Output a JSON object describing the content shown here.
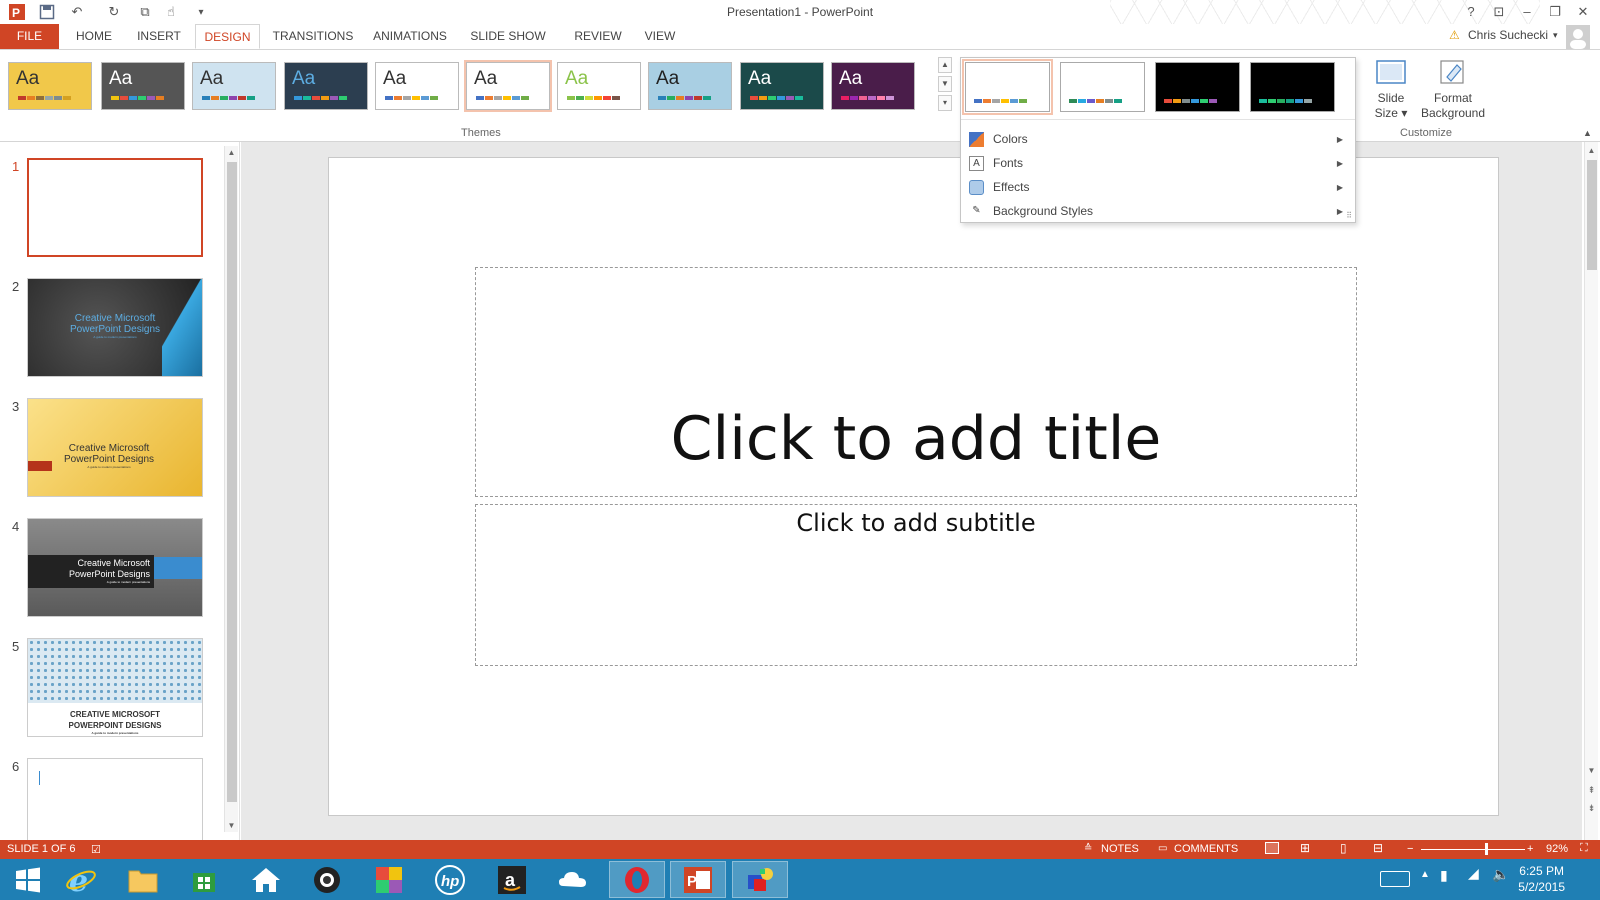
{
  "window": {
    "title": "Presentation1 - PowerPoint"
  },
  "user": {
    "name": "Chris Suchecki"
  },
  "tabs": [
    "FILE",
    "HOME",
    "INSERT",
    "DESIGN",
    "TRANSITIONS",
    "ANIMATIONS",
    "SLIDE SHOW",
    "REVIEW",
    "VIEW"
  ],
  "active_tab": "DESIGN",
  "ribbon": {
    "themes_label": "Themes",
    "customize_label": "Customize",
    "slide_size": {
      "line1": "Slide",
      "line2": "Size ▾"
    },
    "format_background": {
      "line1": "Format",
      "line2": "Background"
    },
    "theme_text": "Aa",
    "themes": [
      {
        "bg": "#f1c84a",
        "text": "#333",
        "swatch": [
          "#c0392b",
          "#e67e22",
          "#8e6e3a",
          "#95a5a6",
          "#7f8c8d",
          "#d4a020"
        ]
      },
      {
        "bg": "#555",
        "text": "#fff",
        "swatch": [
          "#f1c40f",
          "#e74c3c",
          "#3498db",
          "#2ecc71",
          "#9b59b6",
          "#e67e22"
        ]
      },
      {
        "bg": "#cfe3f0",
        "text": "#333",
        "swatch": [
          "#2980b9",
          "#e67e22",
          "#27ae60",
          "#8e44ad",
          "#c0392b",
          "#16a085"
        ]
      },
      {
        "bg": "#2c3e50",
        "text": "#5dade2",
        "swatch": [
          "#3498db",
          "#1abc9c",
          "#e74c3c",
          "#f39c12",
          "#9b59b6",
          "#2ecc71"
        ]
      },
      {
        "bg": "#ffffff",
        "text": "#333",
        "swatch": [
          "#4472c4",
          "#ed7d31",
          "#a5a5a5",
          "#ffc000",
          "#5b9bd5",
          "#70ad47"
        ]
      },
      {
        "bg": "#ffffff",
        "text": "#333",
        "swatch": [
          "#4472c4",
          "#ed7d31",
          "#a5a5a5",
          "#ffc000",
          "#5b9bd5",
          "#70ad47"
        ]
      },
      {
        "bg": "#ffffff",
        "text": "#8bc34a",
        "swatch": [
          "#8bc34a",
          "#4caf50",
          "#cddc39",
          "#ff9800",
          "#f44336",
          "#795548"
        ]
      },
      {
        "bg": "#a9cfe3",
        "text": "#222",
        "swatch": [
          "#2980b9",
          "#27ae60",
          "#e67e22",
          "#8e44ad",
          "#c0392b",
          "#16a085"
        ]
      },
      {
        "bg": "#1b4a4a",
        "text": "#fff",
        "swatch": [
          "#e74c3c",
          "#f39c12",
          "#2ecc71",
          "#3498db",
          "#9b59b6",
          "#1abc9c"
        ]
      },
      {
        "bg": "#4a1d4a",
        "text": "#fff",
        "swatch": [
          "#e91e63",
          "#9c27b0",
          "#f06292",
          "#ba68c8",
          "#ff80ab",
          "#ce93d8"
        ]
      }
    ],
    "variants": [
      {
        "bg": "#ffffff",
        "swatch": [
          "#4472c4",
          "#ed7d31",
          "#a5a5a5",
          "#ffc000",
          "#5b9bd5",
          "#70ad47"
        ]
      },
      {
        "bg": "#ffffff",
        "swatch": [
          "#2e8b57",
          "#27a9e1",
          "#6a5acd",
          "#e67e22",
          "#7f8c8d",
          "#16a085"
        ]
      },
      {
        "bg": "#000000",
        "swatch": [
          "#e74c3c",
          "#f39c12",
          "#7f8c8d",
          "#3498db",
          "#2ecc71",
          "#9b59b6"
        ]
      },
      {
        "bg": "#000000",
        "swatch": [
          "#1abc9c",
          "#2ecc71",
          "#27ae60",
          "#16a085",
          "#3498db",
          "#95a5a6"
        ]
      }
    ],
    "variant_menu": [
      "Colors",
      "Fonts",
      "Effects",
      "Background Styles"
    ]
  },
  "slides": [
    {
      "num": "1",
      "selected": true,
      "style": "blank"
    },
    {
      "num": "2",
      "style": "dark",
      "line1": "Creative Microsoft",
      "line2": "PowerPoint Designs",
      "sub": "A guide to modern presentations"
    },
    {
      "num": "3",
      "style": "yellow",
      "line1": "Creative Microsoft",
      "line2": "PowerPoint Designs",
      "sub": "A guide to modern presentations"
    },
    {
      "num": "4",
      "style": "gray",
      "line1": "Creative Microsoft",
      "line2": "PowerPoint Designs",
      "sub": "A guide to modern presentations"
    },
    {
      "num": "5",
      "style": "pattern",
      "line1": "CREATIVE MICROSOFT",
      "line2": "POWERPOINT DESIGNS",
      "sub": "A guide to modern presentations"
    },
    {
      "num": "6",
      "style": "blank"
    }
  ],
  "slide": {
    "title_placeholder": "Click to add title",
    "subtitle_placeholder": "Click to add subtitle"
  },
  "status": {
    "slide_info": "SLIDE 1 OF 6",
    "notes": "NOTES",
    "comments": "COMMENTS",
    "zoom": "92%",
    "zoom_level": 0.62
  },
  "taskbar": {
    "time": "6:25 PM",
    "date": "5/2/2015"
  },
  "colors": {
    "accent": "#d04525",
    "taskbar": "#1f7fb4"
  }
}
